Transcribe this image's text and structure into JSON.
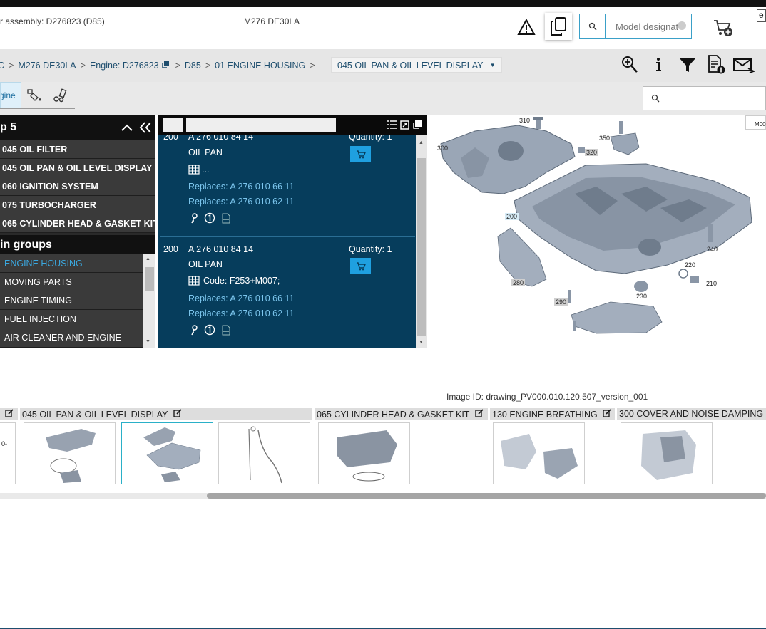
{
  "header": {
    "assembly_text": "r assembly: D276823 (D85)",
    "model_text": "M276 DE30LA",
    "search_placeholder": "Model designat",
    "corner_char": "e"
  },
  "breadcrumb": {
    "items": [
      "C",
      "M276 DE30LA",
      "Engine: D276823",
      "D85",
      "01 ENGINE HOUSING"
    ],
    "separator": ">",
    "current": "045 OIL PAN & OIL LEVEL DISPLAY"
  },
  "tabs": {
    "engine_label": "gine"
  },
  "left_panel": {
    "header": "p 5",
    "items": [
      "045 OIL FILTER",
      "045 OIL PAN & OIL LEVEL DISPLAY",
      "060 IGNITION SYSTEM",
      "075 TURBOCHARGER",
      "065 CYLINDER HEAD & GASKET KIT"
    ],
    "main_groups_header": "in groups",
    "main_groups": [
      "ENGINE HOUSING",
      "MOVING PARTS",
      "ENGINE TIMING",
      "FUEL INJECTION",
      "AIR CLEANER AND ENGINE"
    ]
  },
  "parts": [
    {
      "pos": "200",
      "number": "A 276 010 84 14",
      "name": "OIL PAN",
      "code": "...",
      "replaces": [
        "Replaces: A 276 010 66 11",
        "Replaces: A 276 010 62 11"
      ],
      "quantity": "Quantity: 1"
    },
    {
      "pos": "200",
      "number": "A 276 010 84 14",
      "name": "OIL PAN",
      "code": "Code: F253+M007;",
      "replaces": [
        "Replaces: A 276 010 66 11",
        "Replaces: A 276 010 62 11"
      ],
      "quantity": "Quantity: 1"
    }
  ],
  "diagram": {
    "callouts": [
      "310",
      "300",
      "320",
      "350",
      "200",
      "240",
      "220",
      "210",
      "280",
      "230",
      "290"
    ],
    "legend": [
      "M00"
    ],
    "image_id": "Image ID: drawing_PV000.010.120.507_version_001"
  },
  "strip": {
    "labels": [
      "045 OIL PAN & OIL LEVEL DISPLAY",
      "065 CYLINDER HEAD & GASKET KIT",
      "130 ENGINE BREATHING",
      "300 COVER AND NOISE DAMPING"
    ],
    "first_thumb_text": "0-"
  },
  "colors": {
    "accent": "#1fa0e0",
    "mid_panel": "#063d5c",
    "link": "#1e4e6e"
  }
}
